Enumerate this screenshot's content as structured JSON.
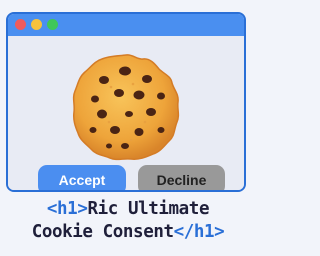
{
  "window": {
    "controls": [
      {
        "name": "close",
        "icon": "close-dot-icon",
        "color": "#f05b5b"
      },
      {
        "name": "minimize",
        "icon": "minimize-dot-icon",
        "color": "#f7c23c"
      },
      {
        "name": "maximize",
        "icon": "maximize-dot-icon",
        "color": "#3fc75a"
      }
    ],
    "titlebar_color": "#4a8ff0",
    "border_color": "#2a6fd6"
  },
  "illustration": {
    "icon": "cookie-icon"
  },
  "buttons": {
    "accept_label": "Accept",
    "decline_label": "Decline",
    "accept_color": "#4b8ef0",
    "decline_color": "#999999"
  },
  "caption": {
    "open_tag": "<h1>",
    "line1_text": "Ric Ultimate",
    "line2_text": "Cookie Consent",
    "close_tag": "</h1>",
    "tag_color": "#2a6fd6",
    "text_color": "#1f1f3a"
  }
}
